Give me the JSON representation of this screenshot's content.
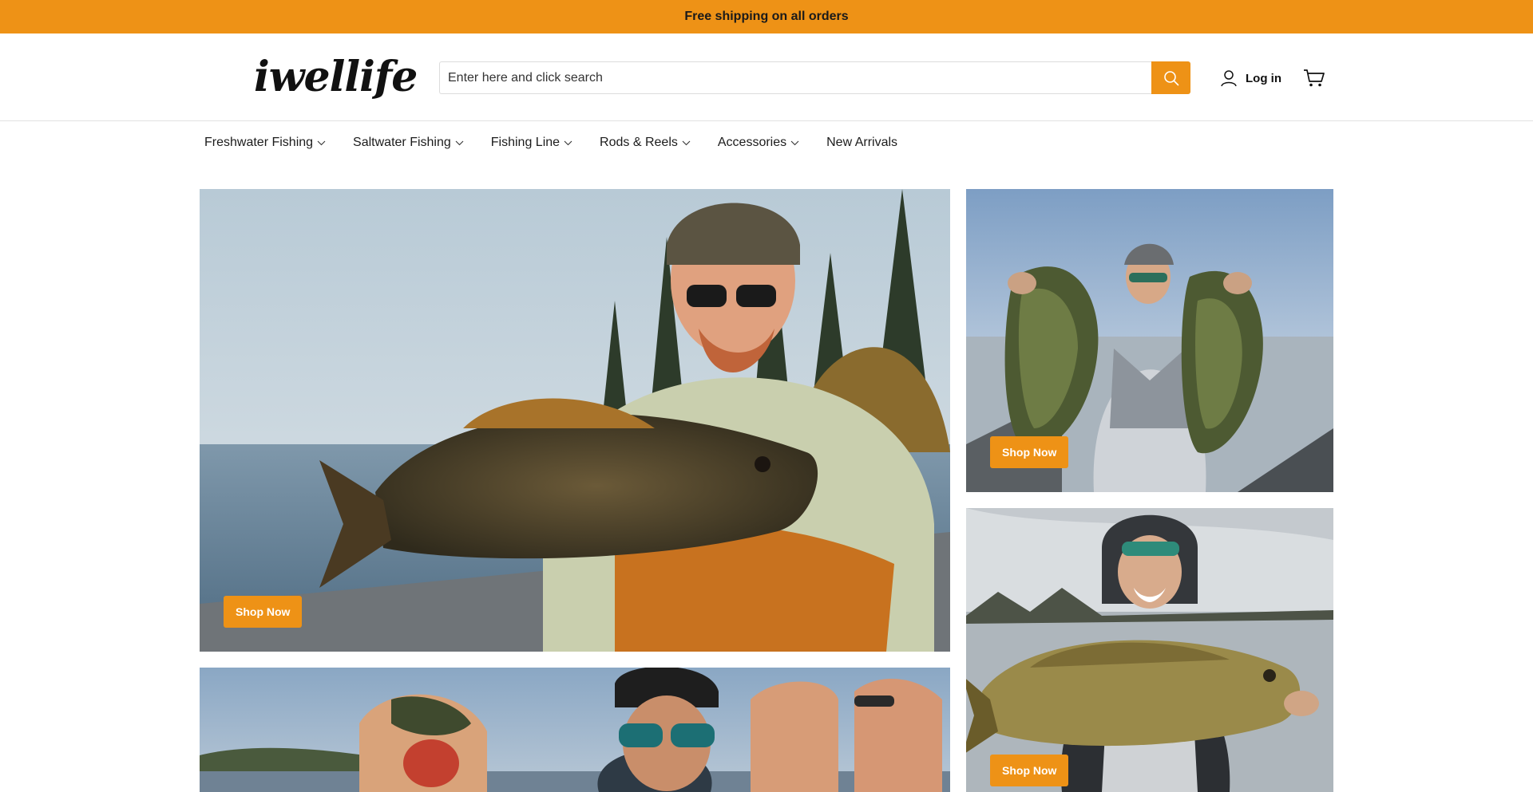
{
  "announcement": {
    "text": "Free shipping on all orders"
  },
  "header": {
    "logo": "iwellife",
    "search": {
      "placeholder": "Enter here and click search",
      "value": ""
    },
    "login_label": "Log in"
  },
  "nav": {
    "items": [
      {
        "label": "Freshwater Fishing",
        "dropdown": true
      },
      {
        "label": "Saltwater Fishing",
        "dropdown": true
      },
      {
        "label": "Fishing Line",
        "dropdown": true
      },
      {
        "label": "Rods & Reels",
        "dropdown": true
      },
      {
        "label": "Accessories",
        "dropdown": true
      },
      {
        "label": "New Arrivals",
        "dropdown": false
      }
    ]
  },
  "banners": [
    {
      "cta": "Shop Now"
    },
    {
      "cta": "Shop Now"
    },
    {
      "cta": "Shop Now"
    }
  ],
  "colors": {
    "accent": "#EE9216",
    "text": "#1c1c1c",
    "border": "#e1e1e1"
  },
  "icons": [
    "search-icon",
    "user-icon",
    "cart-icon",
    "chevron-down-icon"
  ]
}
